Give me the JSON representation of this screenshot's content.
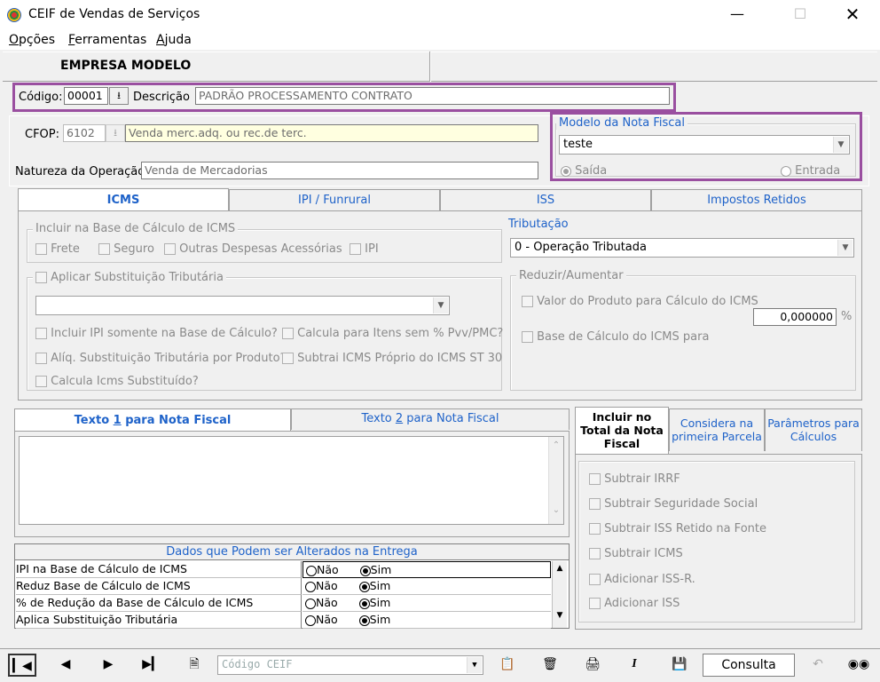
{
  "window": {
    "title": "CEIF de Vendas de Serviços"
  },
  "menu": {
    "items": [
      {
        "underline": "O",
        "rest": "pções"
      },
      {
        "underline": "F",
        "rest": "erramentas"
      },
      {
        "underline": "A",
        "rest": "juda"
      }
    ]
  },
  "header": {
    "empresa": "EMPRESA MODELO"
  },
  "codigo": {
    "label": "Código:",
    "value": "00001",
    "desc_label": "Descrição",
    "desc_value": "PADRÃO PROCESSAMENTO CONTRATO"
  },
  "cfop": {
    "label": "CFOP:",
    "value": "6102",
    "desc": "Venda merc.adq. ou rec.de terc."
  },
  "natureza": {
    "label": "Natureza da Operação:",
    "value": "Venda de Mercadorias"
  },
  "modelo_nf": {
    "title": "Modelo da Nota Fiscal",
    "value": "teste",
    "saida": "Saída",
    "entrada": "Entrada"
  },
  "tabs": {
    "icms": "ICMS",
    "ipi": "IPI / Funrural",
    "iss": "ISS",
    "retidos": "Impostos Retidos"
  },
  "icms": {
    "base_title": "Incluir na Base de Cálculo de ICMS",
    "frete": "Frete",
    "seguro": "Seguro",
    "outras": "Outras Despesas Acessórias",
    "ipi": "IPI",
    "subst_title": "Aplicar Substituição Tributária",
    "incl_ipi": "Incluir IPI somente na Base de Cálculo?",
    "calc_itens": "Calcula para Itens sem % Pvv/PMC?",
    "aliq_subst": "Alíq. Substituição Tributária por Produto?",
    "subtrai_icms": "Subtrai ICMS Próprio do ICMS ST 30",
    "calc_subst": "Calcula Icms Substituído?",
    "trib_title": "Tributação",
    "trib_value": "0 - Operação Tributada",
    "reduzir_title": "Reduzir/Aumentar",
    "valor_prod": "Valor do Produto para Cálculo do ICMS",
    "base_calc": "Base de Cálculo do ICMS para",
    "percent_value": "0,000000",
    "percent_sign": "%"
  },
  "texto_tabs": {
    "t1_pre": "Texto ",
    "t1_num": "1",
    "t1_post": " para Nota Fiscal",
    "t2_pre": "Texto ",
    "t2_num": "2",
    "t2_post": " para Nota Fiscal"
  },
  "right_tabs": {
    "incluir": "Incluir no Total da Nota Fiscal",
    "considera": "Considera na primeira Parcela",
    "parametros": "Parâmetros para Cálculos"
  },
  "incluir_opts": [
    "Subtrair IRRF",
    "Subtrair Seguridade Social",
    "Subtrair ISS Retido na Fonte",
    "Subtrair ICMS",
    "Adicionar ISS-R.",
    "Adicionar ISS"
  ],
  "entrega": {
    "title": "Dados que Podem ser Alterados na Entrega",
    "no": "Não",
    "yes": "Sim",
    "rows": [
      {
        "label": "IPI na Base de Cálculo de ICMS"
      },
      {
        "label": "Reduz Base de Cálculo de ICMS"
      },
      {
        "label": "% de Redução da Base de Cálculo de ICMS"
      },
      {
        "label": "Aplica Substituição Tributária"
      }
    ]
  },
  "toolbar": {
    "combo_placeholder": "Código CEIF",
    "mode": "Consulta"
  }
}
